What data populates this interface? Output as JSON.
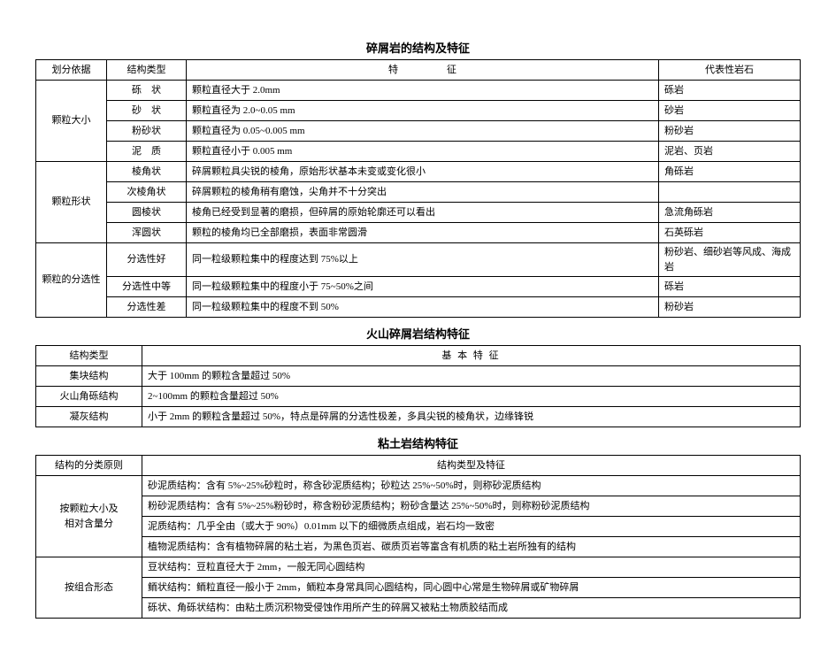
{
  "table1": {
    "title": "碎屑岩的结构及特征",
    "headers": [
      "划分依据",
      "结构类型",
      "特　　　　　征",
      "代表性岩石"
    ],
    "groups": [
      {
        "basis": "颗粒大小",
        "rows": [
          {
            "type": "砾　状",
            "feature": "颗粒直径大于 2.0mm",
            "rep": "砾岩"
          },
          {
            "type": "砂　状",
            "feature": "颗粒直径为 2.0~0.05 mm",
            "rep": "砂岩"
          },
          {
            "type": "粉砂状",
            "feature": "颗粒直径为 0.05~0.005 mm",
            "rep": "粉砂岩"
          },
          {
            "type": "泥　质",
            "feature": "颗粒直径小于 0.005 mm",
            "rep": "泥岩、页岩"
          }
        ]
      },
      {
        "basis": "颗粒形状",
        "rows": [
          {
            "type": "棱角状",
            "feature": "碎屑颗粒具尖锐的棱角，原始形状基本未变或变化很小",
            "rep": "角砾岩"
          },
          {
            "type": "次棱角状",
            "feature": "碎屑颗粒的棱角稍有磨蚀，尖角并不十分突出",
            "rep": ""
          },
          {
            "type": "圆棱状",
            "feature": "棱角已经受到显著的磨损，但碎屑的原始轮廓还可以看出",
            "rep": "急流角砾岩"
          },
          {
            "type": "浑圆状",
            "feature": "颗粒的棱角均已全部磨损，表面非常圆滑",
            "rep": "石英砾岩"
          }
        ]
      },
      {
        "basis": "颗粒的分选性",
        "rows": [
          {
            "type": "分选性好",
            "feature": "同一粒级颗粒集中的程度达到 75%以上",
            "rep": "粉砂岩、细砂岩等风成、海成岩"
          },
          {
            "type": "分选性中等",
            "feature": "同一粒级颗粒集中的程度小于 75~50%之间",
            "rep": "砾岩"
          },
          {
            "type": "分选性差",
            "feature": "同一粒级颗粒集中的程度不到 50%",
            "rep": "粉砂岩"
          }
        ]
      }
    ]
  },
  "table2": {
    "title": "火山碎屑岩结构特征",
    "headers": [
      "结构类型",
      "基 本 特 征"
    ],
    "rows": [
      {
        "type": "集块结构",
        "feature": "大于 100mm 的颗粒含量超过 50%"
      },
      {
        "type": "火山角砾结构",
        "feature": "2~100mm 的颗粒含量超过 50%"
      },
      {
        "type": "凝灰结构",
        "feature": "小于 2mm 的颗粒含量超过 50%，特点是碎屑的分选性极差，多具尖锐的棱角状，边缘锋锐"
      }
    ]
  },
  "table3": {
    "title": "粘土岩结构特征",
    "headers": [
      "结构的分类原则",
      "结构类型及特征"
    ],
    "groups": [
      {
        "basis": "按颗粒大小及\n相对含量分",
        "rows": [
          "砂泥质结构：含有 5%~25%砂粒时，称含砂泥质结构；砂粒达 25%~50%时，则称砂泥质结构",
          "粉砂泥质结构：含有 5%~25%粉砂时，称含粉砂泥质结构；粉砂含量达 25%~50%时，则称粉砂泥质结构",
          "泥质结构：几乎全由（或大于 90%）0.01mm 以下的细微质点组成，岩石均一致密",
          "植物泥质结构：含有植物碎屑的粘土岩，为黑色页岩、碳质页岩等富含有机质的粘土岩所独有的结构"
        ]
      },
      {
        "basis": "按组合形态",
        "rows": [
          "豆状结构：豆粒直径大于 2mm，一般无同心圆结构",
          "鲕状结构：鲕粒直径一般小于 2mm，鲕粒本身常具同心圆结构，同心圆中心常是生物碎屑或矿物碎屑",
          "砾状、角砾状结构：由粘土质沉积物受侵蚀作用所产生的碎屑又被粘土物质胶结而成"
        ]
      }
    ]
  }
}
